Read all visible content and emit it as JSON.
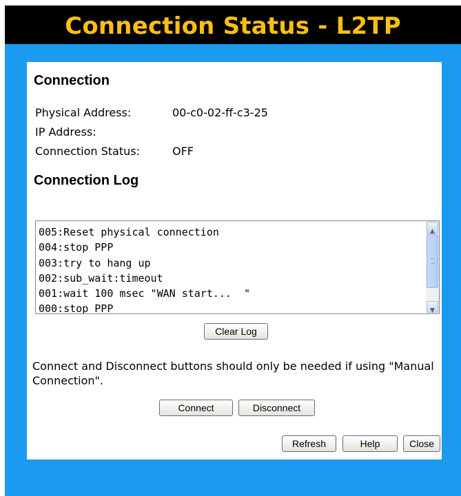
{
  "header": {
    "title": "Connection Status - L2TP"
  },
  "connection": {
    "heading": "Connection",
    "rows": [
      {
        "label": "Physical Address:",
        "value": "00-c0-02-ff-c3-25"
      },
      {
        "label": "IP Address:",
        "value": ""
      },
      {
        "label": "Connection Status:",
        "value": "OFF"
      }
    ]
  },
  "log": {
    "heading": "Connection Log",
    "lines": [
      "005:Reset physical connection",
      "004:stop PPP",
      "003:try to hang up",
      "002:sub_wait:timeout",
      "001:wait 100 msec \"WAN start...  \"",
      "000:stop PPP"
    ],
    "clear_label": "Clear Log"
  },
  "note": "Connect and Disconnect buttons should only be needed if using \"Manual Connection\".",
  "buttons": {
    "connect": "Connect",
    "disconnect": "Disconnect",
    "refresh": "Refresh",
    "help": "Help",
    "close": "Close"
  },
  "colors": {
    "frame": "#1a9bef",
    "title_bg": "#000000",
    "title_text": "#fbbf14"
  }
}
